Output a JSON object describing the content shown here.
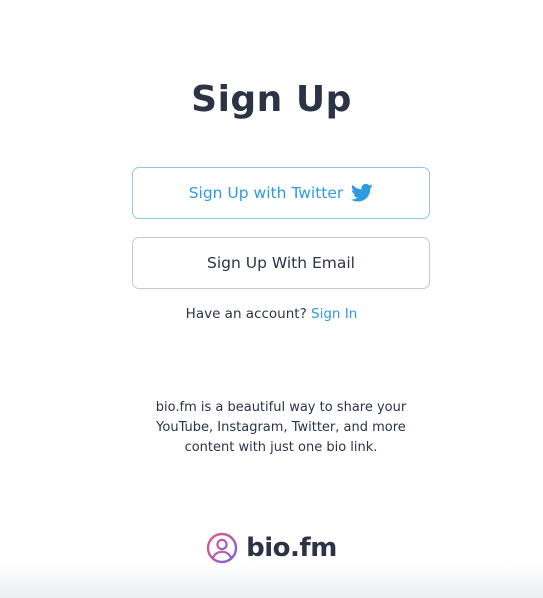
{
  "page": {
    "title": "Sign Up"
  },
  "buttons": {
    "twitter_label": "Sign Up with Twitter",
    "twitter_icon": "twitter-bird-icon",
    "email_label": "Sign Up With Email"
  },
  "signin": {
    "prompt": "Have an account?",
    "link_label": "Sign In"
  },
  "description": "bio.fm is a beautiful way to share your YouTube, Instagram, Twitter, and more content with just one bio link.",
  "brand": {
    "name": "bio.fm",
    "icon": "user-circle-logo-icon"
  },
  "colors": {
    "text": "#2c3345",
    "twitter_blue": "#2f9bdc",
    "link_blue": "#2f9bdc",
    "logo_gradient_start": "#e15b8a",
    "logo_gradient_end": "#7b62d6"
  }
}
